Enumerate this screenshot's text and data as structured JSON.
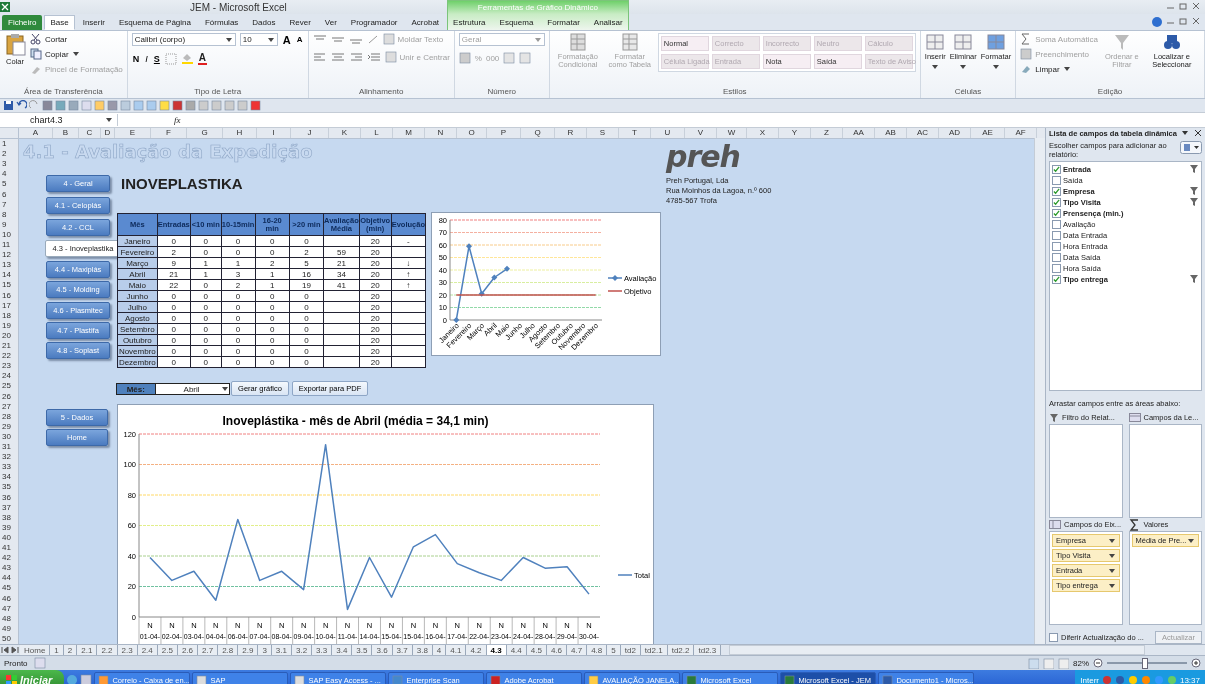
{
  "window": {
    "title": "JEM - Microsoft Excel"
  },
  "ribbon_tabs": [
    {
      "label": "Ficheiro",
      "kind": "file",
      "selected": false
    },
    {
      "label": "Base",
      "kind": "tab",
      "selected": true
    },
    {
      "label": "Inserir",
      "kind": "tab",
      "selected": false
    },
    {
      "label": "Esquema de Página",
      "kind": "tab",
      "selected": false
    },
    {
      "label": "Fórmulas",
      "kind": "tab",
      "selected": false
    },
    {
      "label": "Dados",
      "kind": "tab",
      "selected": false
    },
    {
      "label": "Rever",
      "kind": "tab",
      "selected": false
    },
    {
      "label": "Ver",
      "kind": "tab",
      "selected": false
    },
    {
      "label": "Programador",
      "kind": "tab",
      "selected": false
    },
    {
      "label": "Acrobat",
      "kind": "tab",
      "selected": false
    }
  ],
  "contextual_tabs": {
    "title": "Ferramentas de Gráfico Dinâmico",
    "tabs": [
      {
        "label": "Estrutura",
        "selected": false
      },
      {
        "label": "Esquema",
        "selected": false
      },
      {
        "label": "Formatar",
        "selected": false
      },
      {
        "label": "Analisar",
        "selected": false
      }
    ]
  },
  "clipboard": {
    "label": "Área de Transferência",
    "paste": "Colar",
    "cut": "Cortar",
    "copy": "Copiar",
    "format_painter": {
      "label": "Pincel de Formatação",
      "disabled": true
    }
  },
  "font": {
    "label": "Tipo de Letra",
    "font_name": "Calibri (corpo)",
    "font_size": "10",
    "grow": "A",
    "shrink": "A",
    "bold": "N",
    "italic": "I",
    "underline": "S",
    "font_color": "A"
  },
  "alignment": {
    "label": "Alinhamento",
    "wrap_text": {
      "label": "Moldar Texto",
      "disabled": true
    },
    "merge": {
      "label": "Unir e Centrar",
      "disabled": true
    }
  },
  "number": {
    "label": "Número",
    "format": {
      "label": "Geral",
      "disabled": true
    },
    "percent": "%",
    "thousands": "000"
  },
  "styles": {
    "label": "Estilos",
    "conditional": "Formatação Condicional",
    "as_table": "Formatar como Tabela",
    "cell_styles": [
      {
        "label": "Normal",
        "disabled": false
      },
      {
        "label": "Correcto",
        "disabled": true
      },
      {
        "label": "Incorrecto",
        "disabled": true
      },
      {
        "label": "Neutro",
        "disabled": true
      },
      {
        "label": "Cálculo",
        "disabled": true
      },
      {
        "label": "Célula Ligada",
        "disabled": true
      },
      {
        "label": "Entrada",
        "disabled": true
      },
      {
        "label": "Nota",
        "disabled": false
      },
      {
        "label": "Saída",
        "disabled": false
      },
      {
        "label": "Texto de Aviso",
        "disabled": true
      }
    ]
  },
  "cells": {
    "label": "Células",
    "buttons": [
      "Inserir",
      "Eliminar",
      "Formatar"
    ]
  },
  "editing": {
    "label": "Edição",
    "autosum": {
      "label": "Soma Automática",
      "disabled": true
    },
    "fill": {
      "label": "Preenchimento",
      "disabled": true
    },
    "clear": {
      "label": "Limpar",
      "disabled": false
    },
    "sort": {
      "label": "Ordenar e Filtrar",
      "disabled": true
    },
    "find": {
      "label": "Localizar e Seleccionar",
      "disabled": false
    }
  },
  "formula_bar": {
    "name_box": "chart4.3",
    "fx": "fx"
  },
  "columns": [
    "A",
    "B",
    "C",
    "D",
    "E",
    "F",
    "G",
    "H",
    "I",
    "J",
    "K",
    "L",
    "M",
    "N",
    "O",
    "P",
    "Q",
    "R",
    "S",
    "T",
    "U",
    "V",
    "W",
    "X",
    "Y",
    "Z",
    "AA",
    "AB",
    "AC",
    "AD",
    "AE",
    "AF"
  ],
  "rows": [
    "1",
    "2",
    "3",
    "4",
    "5",
    "6",
    "7",
    "8",
    "9",
    "10",
    "11",
    "12",
    "13",
    "14",
    "15",
    "16",
    "17",
    "18",
    "19",
    "20",
    "21",
    "22",
    "23",
    "24",
    "25",
    "26",
    "27",
    "28",
    "29",
    "30",
    "31",
    "32",
    "33",
    "34",
    "35",
    "36",
    "37",
    "38",
    "39",
    "40",
    "41",
    "42",
    "43",
    "44",
    "45",
    "46",
    "47",
    "48",
    "49",
    "50"
  ],
  "sheet": {
    "title": "4.1 - Avaliação da Expedição",
    "company_heading": "INOVEPLASTIKA",
    "nav_buttons": [
      {
        "label": "4 - Geral",
        "selected": false
      },
      {
        "label": "4.1 - Celoplás",
        "selected": false
      },
      {
        "label": "4.2 - CCL",
        "selected": false
      },
      {
        "label": "4.3 - Inoveplastika",
        "selected": true
      },
      {
        "label": "4.4 - Maxiplás",
        "selected": false
      },
      {
        "label": "4.5 - Molding",
        "selected": false
      },
      {
        "label": "4.6 - Plasmitec",
        "selected": false
      },
      {
        "label": "4.7 - Plastifa",
        "selected": false
      },
      {
        "label": "4.8 - Soplast",
        "selected": false
      }
    ],
    "nav_buttons_lower": [
      {
        "label": "5 - Dados",
        "selected": false
      },
      {
        "label": "Home",
        "selected": false
      }
    ],
    "logo": {
      "text": "preh",
      "lines": [
        "Preh Portugal, Lda",
        "Rua Moinhos da Lagoa, n.º 600",
        "4785-567 Trofa"
      ]
    },
    "table": {
      "columns": [
        "Mês",
        "Entradas",
        "<10 min",
        "10-15min",
        "16-20 min",
        ">20 min",
        "Avaliação Média",
        "Objetivo (min)",
        "Evolução"
      ],
      "rows": [
        [
          "Janeiro",
          "0",
          "0",
          "0",
          "0",
          "0",
          null,
          "20",
          "-"
        ],
        [
          "Fevereiro",
          "2",
          "0",
          "0",
          "0",
          "2",
          "59",
          "20",
          null
        ],
        [
          "Março",
          "9",
          "1",
          "1",
          "2",
          "5",
          "21",
          "20",
          "↓"
        ],
        [
          "Abril",
          "21",
          "1",
          "3",
          "1",
          "16",
          "34",
          "20",
          "↑"
        ],
        [
          "Maio",
          "22",
          "0",
          "2",
          "1",
          "19",
          "41",
          "20",
          "↑"
        ],
        [
          "Junho",
          "0",
          "0",
          "0",
          "0",
          "0",
          null,
          "20",
          null
        ],
        [
          "Julho",
          "0",
          "0",
          "0",
          "0",
          "0",
          null,
          "20",
          null
        ],
        [
          "Agosto",
          "0",
          "0",
          "0",
          "0",
          "0",
          null,
          "20",
          null
        ],
        [
          "Setembro",
          "0",
          "0",
          "0",
          "0",
          "0",
          null,
          "20",
          null
        ],
        [
          "Outubro",
          "0",
          "0",
          "0",
          "0",
          "0",
          null,
          "20",
          null
        ],
        [
          "Novembro",
          "0",
          "0",
          "0",
          "0",
          "0",
          null,
          "20",
          null
        ],
        [
          "Dezembro",
          "0",
          "0",
          "0",
          "0",
          "0",
          null,
          "20",
          null
        ]
      ]
    },
    "small_chart": {
      "chart_data": {
        "type": "line",
        "categories": [
          "Janeiro",
          "Fevereiro",
          "Março",
          "Abril",
          "Maio",
          "Junho",
          "Julho",
          "Agosto",
          "Setembro",
          "Outubro",
          "Novembro",
          "Dezembro"
        ],
        "legend": "right",
        "series": [
          {
            "name": "Avaliação",
            "color": "#4f81bd",
            "marker": "diamond",
            "values": [
              0,
              59,
              21,
              34,
              41,
              null,
              null,
              null,
              null,
              null,
              null,
              null
            ]
          },
          {
            "name": "Objetivo",
            "color": "#c0504d",
            "values": [
              20,
              20,
              20,
              20,
              20,
              20,
              20,
              20,
              20,
              20,
              20,
              20
            ]
          }
        ],
        "ylim": [
          0,
          80
        ],
        "yticks": [
          0,
          10,
          20,
          30,
          40,
          50,
          60,
          70,
          80
        ],
        "ref_lines": [
          {
            "axis": "y",
            "value": 10,
            "color": "#92d9a8"
          },
          {
            "axis": "y",
            "value": 20,
            "color": "#b6e3a0"
          },
          {
            "axis": "y",
            "value": 30,
            "color": "#d8eea0"
          },
          {
            "axis": "y",
            "value": 40,
            "color": "#eef0a0"
          },
          {
            "axis": "y",
            "value": 50,
            "color": "#ffe699"
          },
          {
            "axis": "y",
            "value": 60,
            "color": "#f8cb8a"
          },
          {
            "axis": "y",
            "value": 70,
            "color": "#f4b0a0"
          },
          {
            "axis": "y",
            "value": 80,
            "color": "#f08080"
          }
        ]
      }
    },
    "month_picker": {
      "label": "Mês:",
      "value": "Abril"
    },
    "buttons": [
      "Gerar gráfico",
      "Exportar para PDF"
    ],
    "big_chart": {
      "category_tags": [
        "N",
        "N",
        "N",
        "N",
        "N",
        "N",
        "N",
        "N",
        "N",
        "N",
        "N",
        "N",
        "N",
        "N",
        "N",
        "N",
        "N",
        "N",
        "N",
        "N",
        "N"
      ],
      "chart_data": {
        "type": "line",
        "title": "Inoveplástika - mês de Abril (média = 34,1 min)",
        "categories": [
          "01-04-",
          "02-04-",
          "03-04-",
          "04-04-",
          "06-04-",
          "07-04-",
          "08-04-",
          "09-04-",
          "10-04-",
          "11-04-",
          "14-04-",
          "15-04-",
          "15-04-",
          "16-04-",
          "17-04-",
          "22-04-",
          "23-04-",
          "24-04-",
          "28-04-",
          "29-04-",
          "30-04-"
        ],
        "legend": "right",
        "series": [
          {
            "name": "Total",
            "color": "#4f81bd",
            "values": [
              39,
              24,
              30,
              11,
              64,
              24,
              30,
              18,
              113,
              5,
              39,
              13,
              46,
              54,
              35,
              29,
              24,
              39,
              32,
              33,
              15
            ]
          }
        ],
        "ylim": [
          0,
          120
        ],
        "yticks": [
          0,
          20,
          40,
          60,
          80,
          100,
          120
        ],
        "ref_lines": [
          {
            "axis": "y",
            "value": 20,
            "color": "#70c1a0"
          },
          {
            "axis": "y",
            "value": 40,
            "color": "#a9d08e"
          },
          {
            "axis": "y",
            "value": 60,
            "color": "#e2ef8a"
          },
          {
            "axis": "y",
            "value": 80,
            "color": "#ffd966"
          },
          {
            "axis": "y",
            "value": 100,
            "color": "#f4b183"
          },
          {
            "axis": "y",
            "value": 120,
            "color": "#f08080"
          }
        ]
      }
    }
  },
  "pivot_panel": {
    "title": "Lista de campos da tabela dinâmica",
    "prompt": "Escolher campos para adicionar ao relatório:",
    "fields": [
      {
        "label": "Entrada",
        "checked": true,
        "filtered": true
      },
      {
        "label": "Saída",
        "checked": false,
        "filtered": false
      },
      {
        "label": "Empresa",
        "checked": true,
        "filtered": true
      },
      {
        "label": "Tipo Visita",
        "checked": true,
        "filtered": true
      },
      {
        "label": "Prensença (min.)",
        "checked": true,
        "filtered": false
      },
      {
        "label": "Avaliação",
        "checked": false,
        "filtered": false
      },
      {
        "label": "Data Entrada",
        "checked": false,
        "filtered": false
      },
      {
        "label": "Hora Entrada",
        "checked": false,
        "filtered": false
      },
      {
        "label": "Data Saída",
        "checked": false,
        "filtered": false
      },
      {
        "label": "Hora Saída",
        "checked": false,
        "filtered": false
      },
      {
        "label": "Tipo entrega",
        "checked": true,
        "filtered": true
      }
    ],
    "areas_prompt": "Arrastar campos entre as áreas abaixo:",
    "report_filter": {
      "label": "Filtro do Relat..."
    },
    "legend_fields": {
      "label": "Campos da Le..."
    },
    "axis_fields": {
      "label": "Campos do Eix...",
      "items": [
        "Empresa",
        "Tipo Visita",
        "Entrada",
        "Tipo entrega"
      ]
    },
    "values": {
      "label": "Valores",
      "items": [
        "Média de Pre..."
      ]
    },
    "defer": {
      "label": "Diferir Actualização do ...",
      "checked": false
    },
    "update_button": "Actualizar"
  },
  "sheet_tabs": [
    {
      "label": "Home",
      "selected": false
    },
    {
      "label": "1",
      "selected": false
    },
    {
      "label": "2",
      "selected": false
    },
    {
      "label": "2.1",
      "selected": false
    },
    {
      "label": "2.2",
      "selected": false
    },
    {
      "label": "2.3",
      "selected": false
    },
    {
      "label": "2.4",
      "selected": false
    },
    {
      "label": "2.5",
      "selected": false
    },
    {
      "label": "2.6",
      "selected": false
    },
    {
      "label": "2.7",
      "selected": false
    },
    {
      "label": "2.8",
      "selected": false
    },
    {
      "label": "2.9",
      "selected": false
    },
    {
      "label": "3",
      "selected": false
    },
    {
      "label": "3.1",
      "selected": false
    },
    {
      "label": "3.2",
      "selected": false
    },
    {
      "label": "3.3",
      "selected": false
    },
    {
      "label": "3.4",
      "selected": false
    },
    {
      "label": "3.5",
      "selected": false
    },
    {
      "label": "3.6",
      "selected": false
    },
    {
      "label": "3.7",
      "selected": false
    },
    {
      "label": "3.8",
      "selected": false
    },
    {
      "label": "4",
      "selected": false
    },
    {
      "label": "4.1",
      "selected": false
    },
    {
      "label": "4.2",
      "selected": false
    },
    {
      "label": "4.3",
      "selected": true
    },
    {
      "label": "4.4",
      "selected": false
    },
    {
      "label": "4.5",
      "selected": false
    },
    {
      "label": "4.6",
      "selected": false
    },
    {
      "label": "4.7",
      "selected": false
    },
    {
      "label": "4.8",
      "selected": false
    },
    {
      "label": "5",
      "selected": false
    },
    {
      "label": "td2",
      "selected": false
    },
    {
      "label": "td2.1",
      "selected": false
    },
    {
      "label": "td2.2",
      "selected": false
    },
    {
      "label": "td2.3",
      "selected": false
    }
  ],
  "status_bar": {
    "text": "Pronto",
    "zoom": {
      "reading": "82%",
      "level": 0.47
    }
  },
  "taskbar": {
    "start": "Iniciar",
    "items": [
      {
        "label": "Correio - Caixa de en...",
        "selected": false
      },
      {
        "label": "SAP",
        "selected": false
      },
      {
        "label": "SAP Easy Access  - ...",
        "selected": false
      },
      {
        "label": "Enterprise Scan",
        "selected": false
      },
      {
        "label": "Adobe Acrobat",
        "selected": false
      },
      {
        "label": "AVALIAÇÃO JANELA...",
        "selected": false
      },
      {
        "label": "Microsoft Excel",
        "selected": false
      },
      {
        "label": "Microsoft Excel - JEM",
        "selected": true
      },
      {
        "label": "Documento1 - Micros...",
        "selected": false
      }
    ],
    "search": "Interr",
    "clock": "13:37"
  }
}
